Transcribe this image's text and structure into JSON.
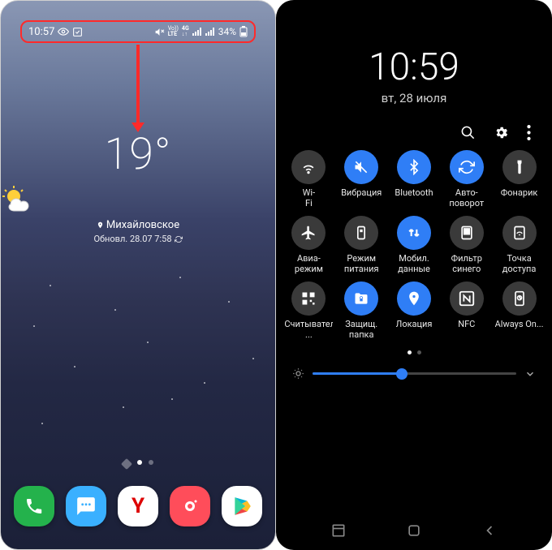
{
  "left": {
    "statusbar": {
      "time": "10:57",
      "indicators": {
        "lte_label": "LTE",
        "net_label": "4G",
        "battery": "34%"
      }
    },
    "weather": {
      "temperature": "19°",
      "city": "Михайловское",
      "updated": "Обновл. 28.07 7:58"
    },
    "dock": {
      "phone": "phone",
      "messages": "messages",
      "yandex": "Y",
      "camera": "camera",
      "play": "play"
    }
  },
  "right": {
    "clock": {
      "time": "10:59",
      "date": "вт, 28 июля"
    },
    "tiles": [
      {
        "id": "wifi",
        "label": "Wi-Fi",
        "on": false
      },
      {
        "id": "vibration",
        "label": "Вибрация",
        "on": true
      },
      {
        "id": "bluetooth",
        "label": "Bluetooth",
        "on": true
      },
      {
        "id": "autorotate",
        "label": "Авто-поворот",
        "on": true
      },
      {
        "id": "flashlight",
        "label": "Фонарик",
        "on": false
      },
      {
        "id": "airplane",
        "label": "Авиа-режим",
        "on": false
      },
      {
        "id": "power",
        "label": "Режим питания",
        "on": false
      },
      {
        "id": "mobiledata",
        "label": "Мобил. данные",
        "on": true
      },
      {
        "id": "bluelight",
        "label": "Фильтр синего",
        "on": false
      },
      {
        "id": "hotspot",
        "label": "Точка доступа",
        "on": false
      },
      {
        "id": "qr",
        "label": "Считыватель ...",
        "on": false
      },
      {
        "id": "securefolder",
        "label": "Защищ. папка",
        "on": true
      },
      {
        "id": "location",
        "label": "Локация",
        "on": true
      },
      {
        "id": "nfc",
        "label": "NFC",
        "on": false
      },
      {
        "id": "aod",
        "label": "Always On...",
        "on": false
      }
    ],
    "brightness_percent": 44
  }
}
